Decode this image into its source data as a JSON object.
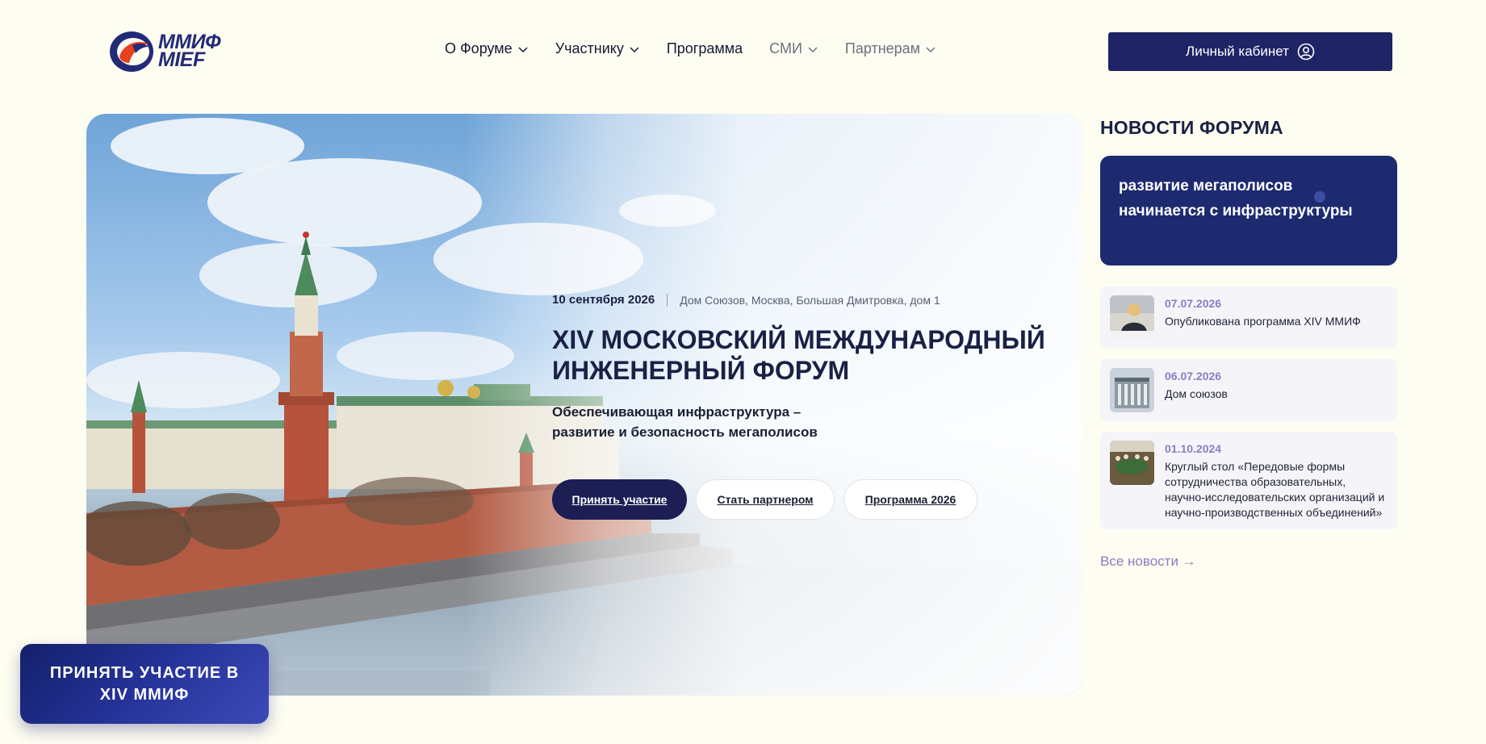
{
  "header": {
    "logo": {
      "text_ru": "ММИФ",
      "text_en": "MIEF"
    },
    "nav": [
      {
        "label": "О Форуме",
        "has_dropdown": true
      },
      {
        "label": "Участнику",
        "has_dropdown": true
      },
      {
        "label": "Программа",
        "has_dropdown": false
      },
      {
        "label": "СМИ",
        "has_dropdown": true
      },
      {
        "label": "Партнерам",
        "has_dropdown": true
      }
    ],
    "login_label": "Личный кабинет"
  },
  "hero": {
    "date": "10 сентября 2026",
    "place": "Дом Союзов, Москва, Большая Дмитровка, дом 1",
    "title": "XIV МОСКОВСКИЙ МЕЖДУНАРОДНЫЙ ИНЖЕНЕРНЫЙ ФОРУМ",
    "subtitle": "Обеспечивающая инфраструктура – развитие и безопасность мегаполисов",
    "buttons": {
      "participate": "Принять участие",
      "partner": "Стать партнером",
      "program": "Программа 2026"
    }
  },
  "news": {
    "title": "НОВОСТИ ФОРУМА",
    "feature": "развитие мегаполисов начинается с инфраструктуры",
    "items": [
      {
        "date": "07.07.2026",
        "headline": "Опубликована программа XIV ММИФ"
      },
      {
        "date": "06.07.2026",
        "headline": "Дом союзов"
      },
      {
        "date": "01.10.2024",
        "headline": "Круглый стол «Передовые формы сотрудничества образовательных, научно-исследовательских организаций и научно-производственных объединений»"
      }
    ],
    "all_link": "Все новости →"
  },
  "cta": {
    "label": "ПРИНЯТЬ УЧАСТИЕ В XIV ММИФ"
  },
  "colors": {
    "background": "#fefdf1",
    "primary": "#1f2466",
    "accent_date": "#8a7dc4",
    "logo_red": "#e8401c"
  }
}
